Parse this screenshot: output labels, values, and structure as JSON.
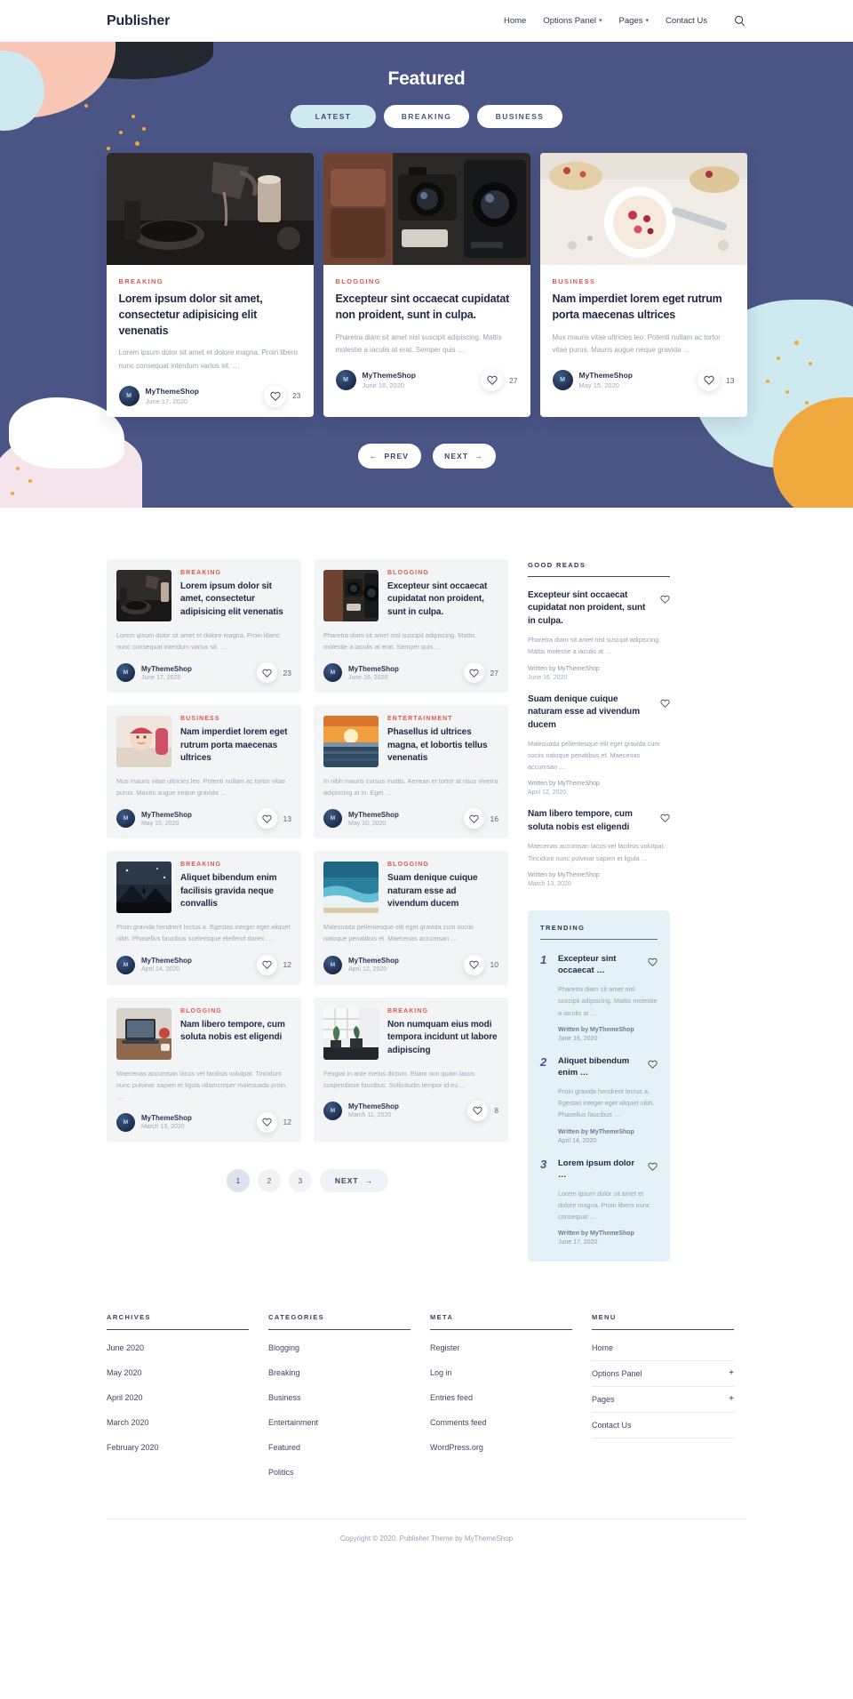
{
  "header": {
    "brand": "Publisher",
    "nav": [
      {
        "label": "Home",
        "has_caret": false
      },
      {
        "label": "Options Panel",
        "has_caret": true
      },
      {
        "label": "Pages",
        "has_caret": true
      },
      {
        "label": "Contact Us",
        "has_caret": false
      }
    ],
    "search_icon": "search-icon"
  },
  "hero": {
    "title": "Featured",
    "tabs": [
      {
        "label": "LATEST",
        "active": true
      },
      {
        "label": "BREAKING",
        "active": false
      },
      {
        "label": "BUSINESS",
        "active": false
      }
    ],
    "prev_label": "PREV",
    "next_label": "NEXT",
    "cards": [
      {
        "category": "BREAKING",
        "title": "Lorem ipsum dolor sit amet, consectetur adipisicing elit venenatis",
        "excerpt": "Lorem ipsum dolor sit amet et dolore magna. Proin libero nunc consequat interdum varius sit. …",
        "author": "MyThemeShop",
        "date": "June 17, 2020",
        "likes": "23",
        "thumb": "coffee-pour-photo"
      },
      {
        "category": "BLOGGING",
        "title": "Excepteur sint occaecat cupidatat non proident, sunt in culpa.",
        "excerpt": "Pharetra diam sit amet nisl suscipit adipiscing. Mattis molestie a iaculis at erat. Semper quis …",
        "author": "MyThemeShop",
        "date": "June 16, 2020",
        "likes": "27",
        "thumb": "cameras-photo"
      },
      {
        "category": "BUSINESS",
        "title": "Nam imperdiet lorem eget rutrum porta maecenas ultrices",
        "excerpt": "Mus mauris vitae ultricies leo. Potenti nullam ac tortor vitae purus. Mauris augue neque gravida …",
        "author": "MyThemeShop",
        "date": "May 15, 2020",
        "likes": "13",
        "thumb": "breakfast-bowl-photo"
      }
    ]
  },
  "posts": [
    {
      "category": "BREAKING",
      "title": "Lorem ipsum dolor sit amet, consectetur adipisicing elit venenatis",
      "excerpt": "Lorem ipsum dolor sit amet et dolore magna. Proin libero nunc consequat interdum varius sit. …",
      "author": "MyThemeShop",
      "date": "June 17, 2020",
      "likes": "23",
      "thumb": "coffee-pour-photo"
    },
    {
      "category": "BLOGGING",
      "title": "Excepteur sint occaecat cupidatat non proident, sunt in culpa.",
      "excerpt": "Pharetra diam sit amet nisl suscipit adipiscing. Mattis molestie a iaculis at erat. Semper quis …",
      "author": "MyThemeShop",
      "date": "June 16, 2020",
      "likes": "27",
      "thumb": "cameras-photo"
    },
    {
      "category": "BUSINESS",
      "title": "Nam imperdiet lorem eget rutrum porta maecenas ultrices",
      "excerpt": "Mus mauris vitae ultricies leo. Potenti nullam ac tortor vitae purus. Mauris augue neque gravida …",
      "author": "MyThemeShop",
      "date": "May 15, 2020",
      "likes": "13",
      "thumb": "baby-photo"
    },
    {
      "category": "ENTERTAINMENT",
      "title": "Phasellus id ultrices magna, et lobortis tellus venenatis",
      "excerpt": "In nibh mauris cursus mattis. Aenean et tortor at risus viverra adipiscing at in. Eget …",
      "author": "MyThemeShop",
      "date": "May 10, 2020",
      "likes": "16",
      "thumb": "sunset-sea-photo"
    },
    {
      "category": "BREAKING",
      "title": "Aliquet bibendum enim facilisis gravida neque convallis",
      "excerpt": "Proin gravida hendrerit lectus a. Egestas integer eget aliquet nibh. Phasellus faucibus scelerisque eleifend donec. …",
      "author": "MyThemeShop",
      "date": "April 14, 2020",
      "likes": "12",
      "thumb": "mountain-night-photo"
    },
    {
      "category": "BLOGGING",
      "title": "Suam denique cuique naturam esse ad vivendum ducem",
      "excerpt": "Malesuada pellentesque elit eget gravida cum sociis natoque penatibus et. Maecenas accumsan …",
      "author": "MyThemeShop",
      "date": "April 12, 2020",
      "likes": "10",
      "thumb": "ocean-aerial-photo"
    },
    {
      "category": "BLOGGING",
      "title": "Nam libero tempore, cum soluta nobis est eligendi",
      "excerpt": "Maecenas accumsan lacus vel facilisis volutpat. Tincidunt nunc pulvinar sapien et ligula ullamcorper malesuada proin. …",
      "author": "MyThemeShop",
      "date": "March 13, 2020",
      "likes": "12",
      "thumb": "desk-laptop-photo"
    },
    {
      "category": "BREAKING",
      "title": "Non numquam eius modi tempora incidunt ut labore adipiscing",
      "excerpt": "Feugiat in ante metus dictum. Etiam non quam lacus suspendisse faucibus. Sollicitudin tempor id eu …",
      "author": "MyThemeShop",
      "date": "March 11, 2020",
      "likes": "8",
      "thumb": "interior-plants-photo"
    }
  ],
  "pagination": {
    "pages": [
      "1",
      "2",
      "3"
    ],
    "active": "1",
    "next_label": "NEXT"
  },
  "sidebar": {
    "good_reads": {
      "title": "GOOD READS",
      "items": [
        {
          "title": "Excepteur sint occaecat cupidatat non proident, sunt in culpa.",
          "excerpt": "Pharetra diam sit amet nisl suscipit adipiscing. Mattis molestie a iaculis at …",
          "written_by": "Written by MyThemeShop",
          "date": "June 16, 2020"
        },
        {
          "title": "Suam denique cuique naturam esse ad vivendum ducem",
          "excerpt": "Malesuada pellentesque elit eget gravida cum sociis natoque penatibus et. Maecenas accumsan …",
          "written_by": "Written by MyThemeShop",
          "date": "April 12, 2020"
        },
        {
          "title": "Nam libero tempore, cum soluta nobis est eligendi",
          "excerpt": "Maecenas accumsan lacus vel facilisis volutpat. Tincidunt nunc pulvinar sapien et ligula …",
          "written_by": "Written by MyThemeShop",
          "date": "March 13, 2020"
        }
      ]
    },
    "trending": {
      "title": "TRENDING",
      "items": [
        {
          "rank": "1",
          "title": "Excepteur sint occaecat …",
          "excerpt": "Pharetra diam sit amet nisl suscipit adipiscing. Mattis molestie a iaculis at …",
          "written_by": "Written by MyThemeShop",
          "date": "June 16, 2020"
        },
        {
          "rank": "2",
          "title": "Aliquet bibendum enim …",
          "excerpt": "Proin gravida hendrerit lectus a. Egestas integer eget aliquet nibh. Phasellus faucibus …",
          "written_by": "Written by MyThemeShop",
          "date": "April 14, 2020"
        },
        {
          "rank": "3",
          "title": "Lorem ipsum dolor …",
          "excerpt": "Lorem ipsum dolor sit amet et dolore magna. Proin libero nunc consequat …",
          "written_by": "Written by MyThemeShop",
          "date": "June 17, 2020"
        }
      ]
    }
  },
  "footer": {
    "columns": [
      {
        "title": "ARCHIVES",
        "menu_style": false,
        "links": [
          {
            "label": "June 2020",
            "expandable": false
          },
          {
            "label": "May 2020",
            "expandable": false
          },
          {
            "label": "April 2020",
            "expandable": false
          },
          {
            "label": "March 2020",
            "expandable": false
          },
          {
            "label": "February 2020",
            "expandable": false
          }
        ]
      },
      {
        "title": "CATEGORIES",
        "menu_style": false,
        "links": [
          {
            "label": "Blogging",
            "expandable": false
          },
          {
            "label": "Breaking",
            "expandable": false
          },
          {
            "label": "Business",
            "expandable": false
          },
          {
            "label": "Entertainment",
            "expandable": false
          },
          {
            "label": "Featured",
            "expandable": false
          },
          {
            "label": "Politics",
            "expandable": false
          }
        ]
      },
      {
        "title": "META",
        "menu_style": false,
        "links": [
          {
            "label": "Register",
            "expandable": false
          },
          {
            "label": "Log in",
            "expandable": false
          },
          {
            "label": "Entries feed",
            "expandable": false
          },
          {
            "label": "Comments feed",
            "expandable": false
          },
          {
            "label": "WordPress.org",
            "expandable": false
          }
        ]
      },
      {
        "title": "MENU",
        "menu_style": true,
        "links": [
          {
            "label": "Home",
            "expandable": false
          },
          {
            "label": "Options Panel",
            "expandable": true
          },
          {
            "label": "Pages",
            "expandable": true
          },
          {
            "label": "Contact Us",
            "expandable": false
          }
        ]
      }
    ],
    "copyright": "Copyright © 2020. Publisher Theme by MyThemeShop"
  },
  "colors": {
    "hero_bg": "#4a5586",
    "accent_red": "#e2574c",
    "tab_active": "#cfe9f0",
    "trending_bg": "#e4f1f6",
    "text_dark": "#212a45"
  }
}
